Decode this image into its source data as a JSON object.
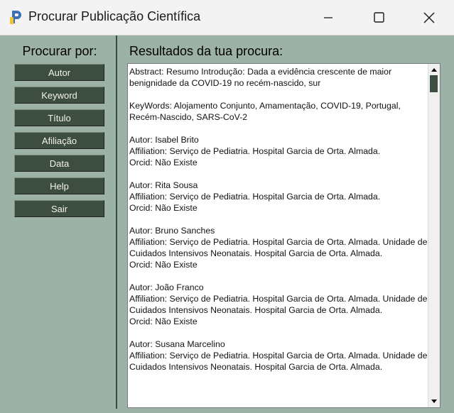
{
  "window": {
    "title": "Procurar Publicação Científica"
  },
  "sidebar": {
    "title": "Procurar por:",
    "buttons": [
      {
        "label": "Autor"
      },
      {
        "label": "Keyword"
      },
      {
        "label": "Título"
      },
      {
        "label": "Afiliação"
      },
      {
        "label": "Data"
      },
      {
        "label": "Help"
      },
      {
        "label": "Sair"
      }
    ]
  },
  "results": {
    "title": "Resultados da tua procura:",
    "text": "Abstract: Resumo Introdução: Dada a evidência crescente de maior benignidade da COVID-19 no recém-nascido, sur\n\nKeyWords: Alojamento Conjunto, Amamentação, COVID-19, Portugal, Recém-Nascido, SARS-CoV-2\n\nAutor: Isabel Brito\nAffiliation: Serviço de Pediatria. Hospital Garcia de Orta. Almada.\nOrcid: Não Existe\n\nAutor: Rita Sousa\nAffiliation: Serviço de Pediatria. Hospital Garcia de Orta. Almada.\nOrcid: Não Existe\n\nAutor: Bruno Sanches\nAffiliation: Serviço de Pediatria. Hospital Garcia de Orta. Almada. Unidade de Cuidados Intensivos Neonatais. Hospital Garcia de Orta. Almada.\nOrcid: Não Existe\n\nAutor: João Franco\nAffiliation: Serviço de Pediatria. Hospital Garcia de Orta. Almada. Unidade de Cuidados Intensivos Neonatais. Hospital Garcia de Orta. Almada.\nOrcid: Não Existe\n\nAutor: Susana Marcelino\nAffiliation: Serviço de Pediatria. Hospital Garcia de Orta. Almada. Unidade de Cuidados Intensivos Neonatais. Hospital Garcia de Orta. Almada."
  },
  "colors": {
    "background": "#9db2a6",
    "button": "#3d4d3f",
    "titlebar": "#f3f3f3"
  },
  "icons": [
    "app-icon",
    "minimize-icon",
    "maximize-icon",
    "close-icon",
    "scroll-up-icon",
    "scroll-down-icon"
  ]
}
